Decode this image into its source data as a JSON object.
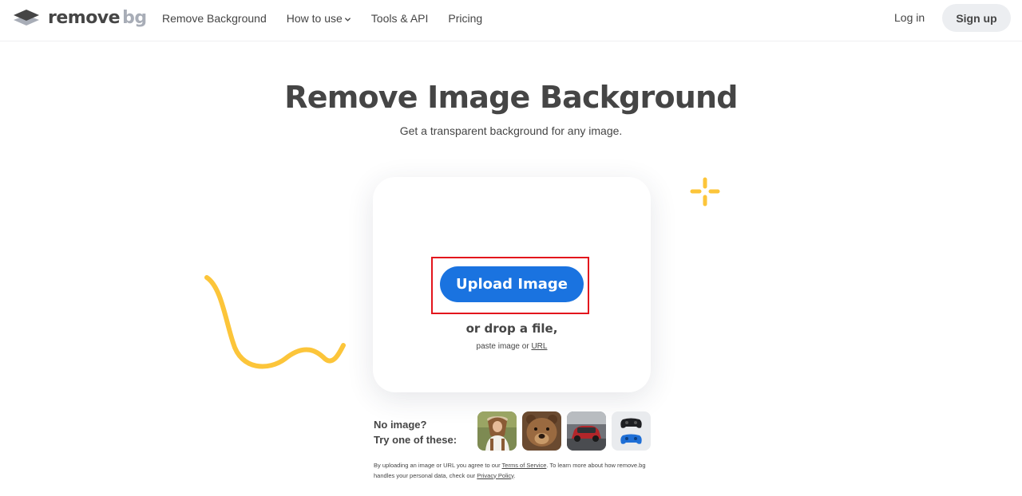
{
  "header": {
    "logo_text_main": "remove",
    "logo_text_accent": "bg",
    "nav": [
      {
        "label": "Remove Background"
      },
      {
        "label": "How to use"
      },
      {
        "label": "Tools & API"
      },
      {
        "label": "Pricing"
      }
    ],
    "login_label": "Log in",
    "signup_label": "Sign up"
  },
  "hero": {
    "title": "Remove Image Background",
    "subtitle": "Get a transparent background for any image."
  },
  "upload": {
    "button_label": "Upload Image",
    "drop_text": "or drop a file,",
    "paste_prefix": "paste image or ",
    "paste_link": "URL"
  },
  "samples": {
    "line1": "No image?",
    "line2": "Try one of these:",
    "items": [
      {
        "icon": "woman-photo-icon"
      },
      {
        "icon": "bear-photo-icon"
      },
      {
        "icon": "car-photo-icon"
      },
      {
        "icon": "gamepads-photo-icon"
      }
    ]
  },
  "legal": {
    "part1": "By uploading an image or URL you agree to our ",
    "terms_link": "Terms of Service",
    "part2": ". To learn more about how remove.bg handles your personal data, check our ",
    "privacy_link": "Privacy Policy",
    "part3": "."
  },
  "colors": {
    "primary_button": "#1a73e0",
    "highlight_border": "#e3151d",
    "decoration_yellow": "#fcc53a",
    "signup_bg": "#eceef1"
  }
}
